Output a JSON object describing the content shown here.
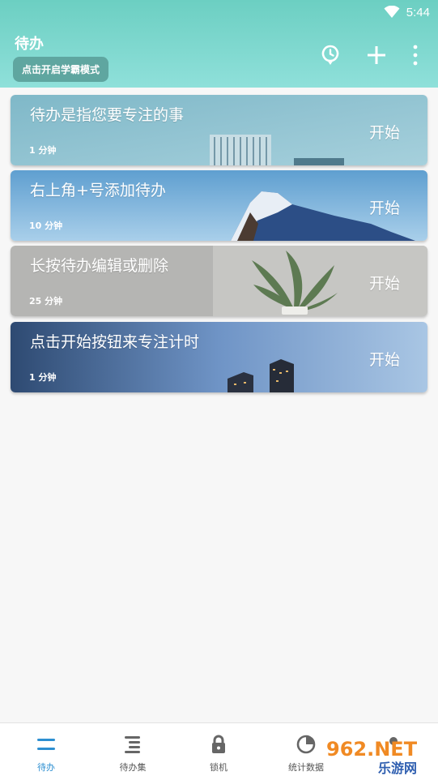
{
  "status_bar": {
    "time": "5:44"
  },
  "header": {
    "title": "待办",
    "mode_button": "点击开启学霸模式"
  },
  "tasks": [
    {
      "title": "待办是指您要专注的事",
      "duration": "1 分钟",
      "action": "开始"
    },
    {
      "title": "右上角+号添加待办",
      "duration": "10 分钟",
      "action": "开始"
    },
    {
      "title": "长按待办编辑或删除",
      "duration": "25 分钟",
      "action": "开始"
    },
    {
      "title": "点击开始按钮来专注计时",
      "duration": "1 分钟",
      "action": "开始"
    }
  ],
  "bottom_nav": [
    {
      "label": "待办",
      "icon": "todo-list-icon",
      "active": true
    },
    {
      "label": "待办集",
      "icon": "todo-set-icon",
      "active": false
    },
    {
      "label": "锁机",
      "icon": "lock-icon",
      "active": false
    },
    {
      "label": "统计数据",
      "icon": "pie-chart-icon",
      "active": false
    },
    {
      "label": "",
      "icon": "profile-icon",
      "active": false
    }
  ],
  "watermark": {
    "line1": "962.NET",
    "line2": "乐游网"
  },
  "colors": {
    "header_top": "#6ccfc2",
    "header_bottom": "#8fe0da",
    "nav_active": "#2d8fd1",
    "nav_inactive": "#555555"
  }
}
